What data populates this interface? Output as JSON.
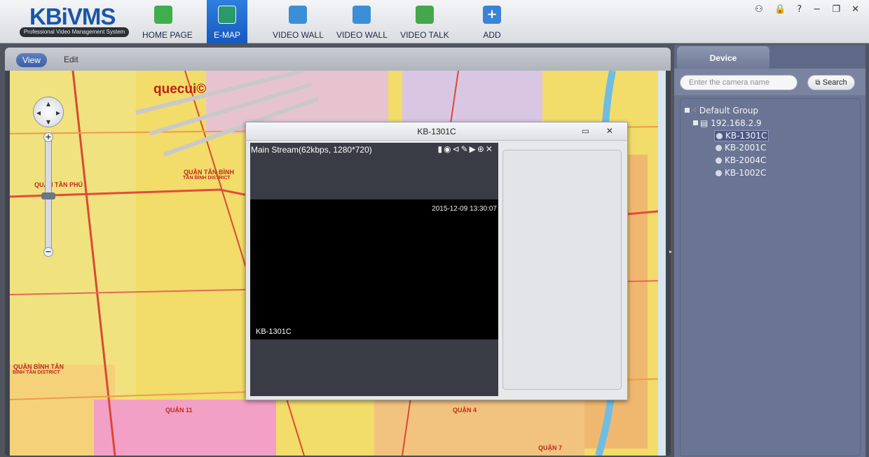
{
  "app": {
    "logo_main": "KBiVMS",
    "logo_sub": "Professional Video Management System",
    "window_controls": "⚇ 🔒 ? − ❐ ✕"
  },
  "nav": [
    {
      "label": "HOME PAGE",
      "icon": "home-icon",
      "color": "#3fae4b"
    },
    {
      "label": "E-MAP",
      "icon": "emap-icon",
      "color": "#2a9a6c"
    },
    {
      "label": "VIDEO WALL",
      "icon": "video-wall-icon",
      "color": "#3b8fd6"
    },
    {
      "label": "VIDEO WALL",
      "icon": "video-wall-config-icon",
      "color": "#3b8fd6"
    },
    {
      "label": "VIDEO TALK",
      "icon": "video-talk-icon",
      "color": "#46a64b"
    },
    {
      "label": "ADD",
      "icon": "add-icon",
      "color": "#3a84d8"
    }
  ],
  "map_panel": {
    "tabs": {
      "view": "View",
      "edit": "Edit"
    },
    "brand_label": "quecui©",
    "labels": [
      "QUẬN TÂN BÌNH",
      "TÂN BÌNH DISTRICT",
      "QUẬN TÂN PHÚ",
      "QUẬN BÌNH TÂN",
      "BÌNH TÂN DISTRICT",
      "QUẬN 4",
      "QUẬN 7",
      "QUẬN 11"
    ]
  },
  "popup": {
    "title": "KB-1301C",
    "controls": "▭ ✕",
    "stream_info": "Main Stream(62kbps, 1280*720)",
    "tools": "▮◉⊲✎▶⊕✕",
    "timestamp": "2015-12-09 13:30:07",
    "camera_label": "KB-1301C"
  },
  "device_panel": {
    "tab": "Device",
    "search_placeholder": "Enter the camera name",
    "search_label": "Search",
    "tree": {
      "group": "Default Group",
      "device": "192.168.2.9",
      "cameras": [
        "KB-1301C",
        "KB-2001C",
        "KB-2004C",
        "KB-1002C"
      ],
      "selected": "KB-1301C"
    }
  }
}
